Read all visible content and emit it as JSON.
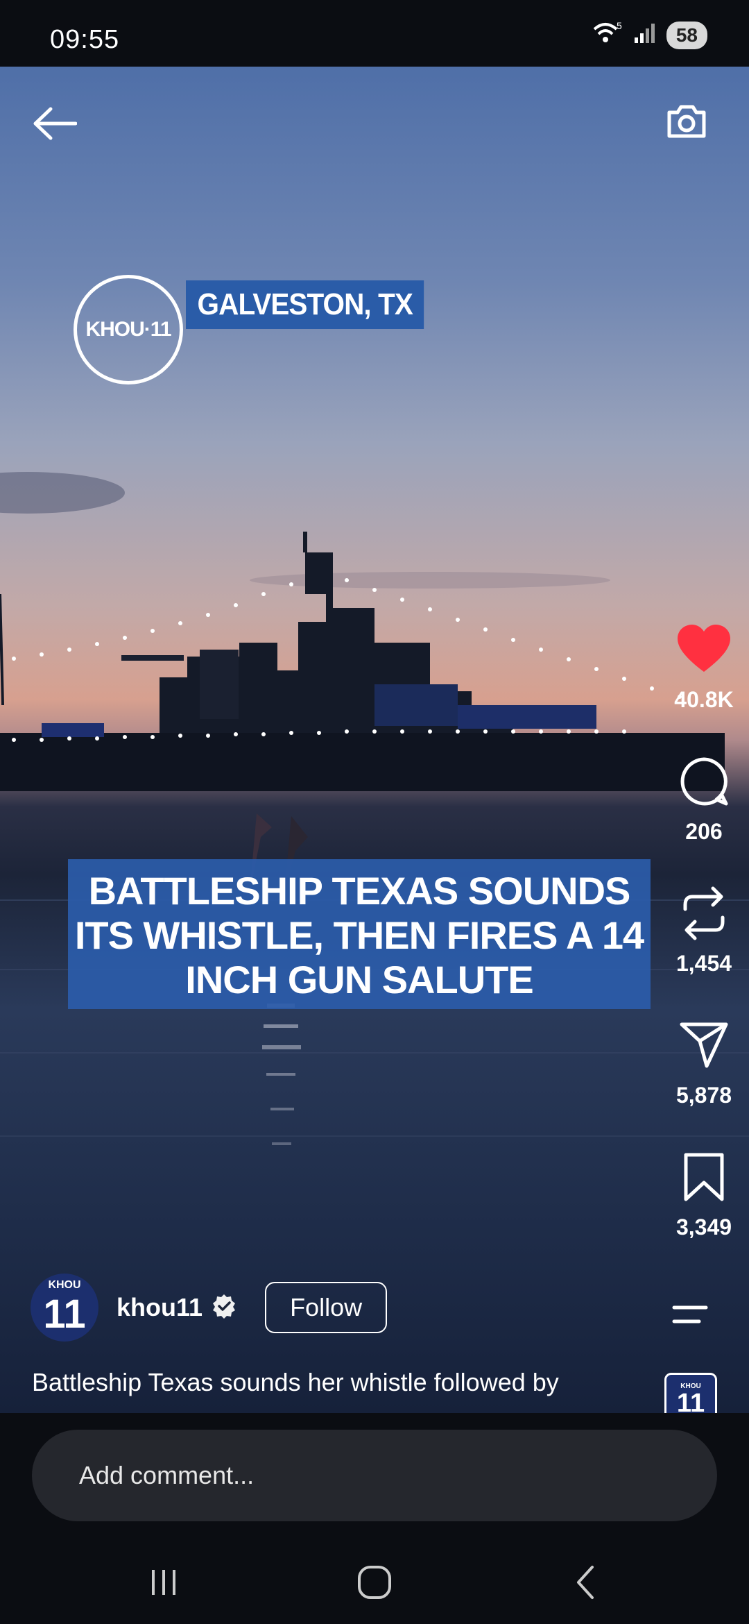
{
  "status_bar": {
    "time": "09:55",
    "network": "5",
    "battery": "58",
    "icons": [
      "wifi-icon",
      "signal-icon",
      "battery-icon"
    ]
  },
  "video": {
    "logo_text": "KHOU·11",
    "location": "GALVESTON, TX",
    "headline_lines": [
      "BATTLESHIP TEXAS SOUNDS",
      "ITS WHISTLE, THEN FIRES A 14",
      "INCH GUN SALUTE"
    ]
  },
  "actions": {
    "like_count": "40.8K",
    "comment_count": "206",
    "repost_count": "1,454",
    "share_count": "5,878",
    "save_count": "3,349",
    "like_color": "#ff3040"
  },
  "author": {
    "avatar_small": "KHOU",
    "avatar_big": "11",
    "username": "khou11",
    "follow_label": "Follow"
  },
  "caption": {
    "text": "Battleship Texas sounds her whistle followed by",
    "more": "..."
  },
  "audio": {
    "small": "KHOU",
    "big": "11"
  },
  "comment": {
    "placeholder": "Add comment..."
  }
}
